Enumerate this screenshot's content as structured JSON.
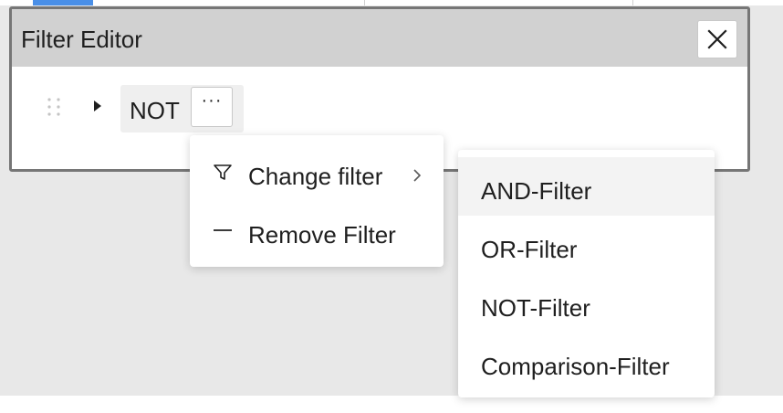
{
  "dialog": {
    "title": "Filter Editor",
    "close_label": "X"
  },
  "filter_node": {
    "label": "NOT",
    "menu_button_label": "···"
  },
  "context_menu": {
    "items": [
      {
        "label": "Change filter",
        "icon": "filter-icon",
        "has_submenu": true
      },
      {
        "label": "Remove Filter",
        "icon": "minus-icon",
        "has_submenu": false
      }
    ]
  },
  "submenu": {
    "active_item": "AND-Filter",
    "items": [
      {
        "label": "AND-Filter"
      },
      {
        "label": "OR-Filter"
      },
      {
        "label": "NOT-Filter"
      },
      {
        "label": "Comparison-Filter"
      }
    ]
  },
  "colors": {
    "dialog_header": "#d1d1d1",
    "dialog_border": "#767676",
    "background": "#e8e8e8",
    "chip": "#efefef",
    "selected_tab_accent": "#4a8fe7",
    "active_submenu_item": "#f3f3f3"
  }
}
